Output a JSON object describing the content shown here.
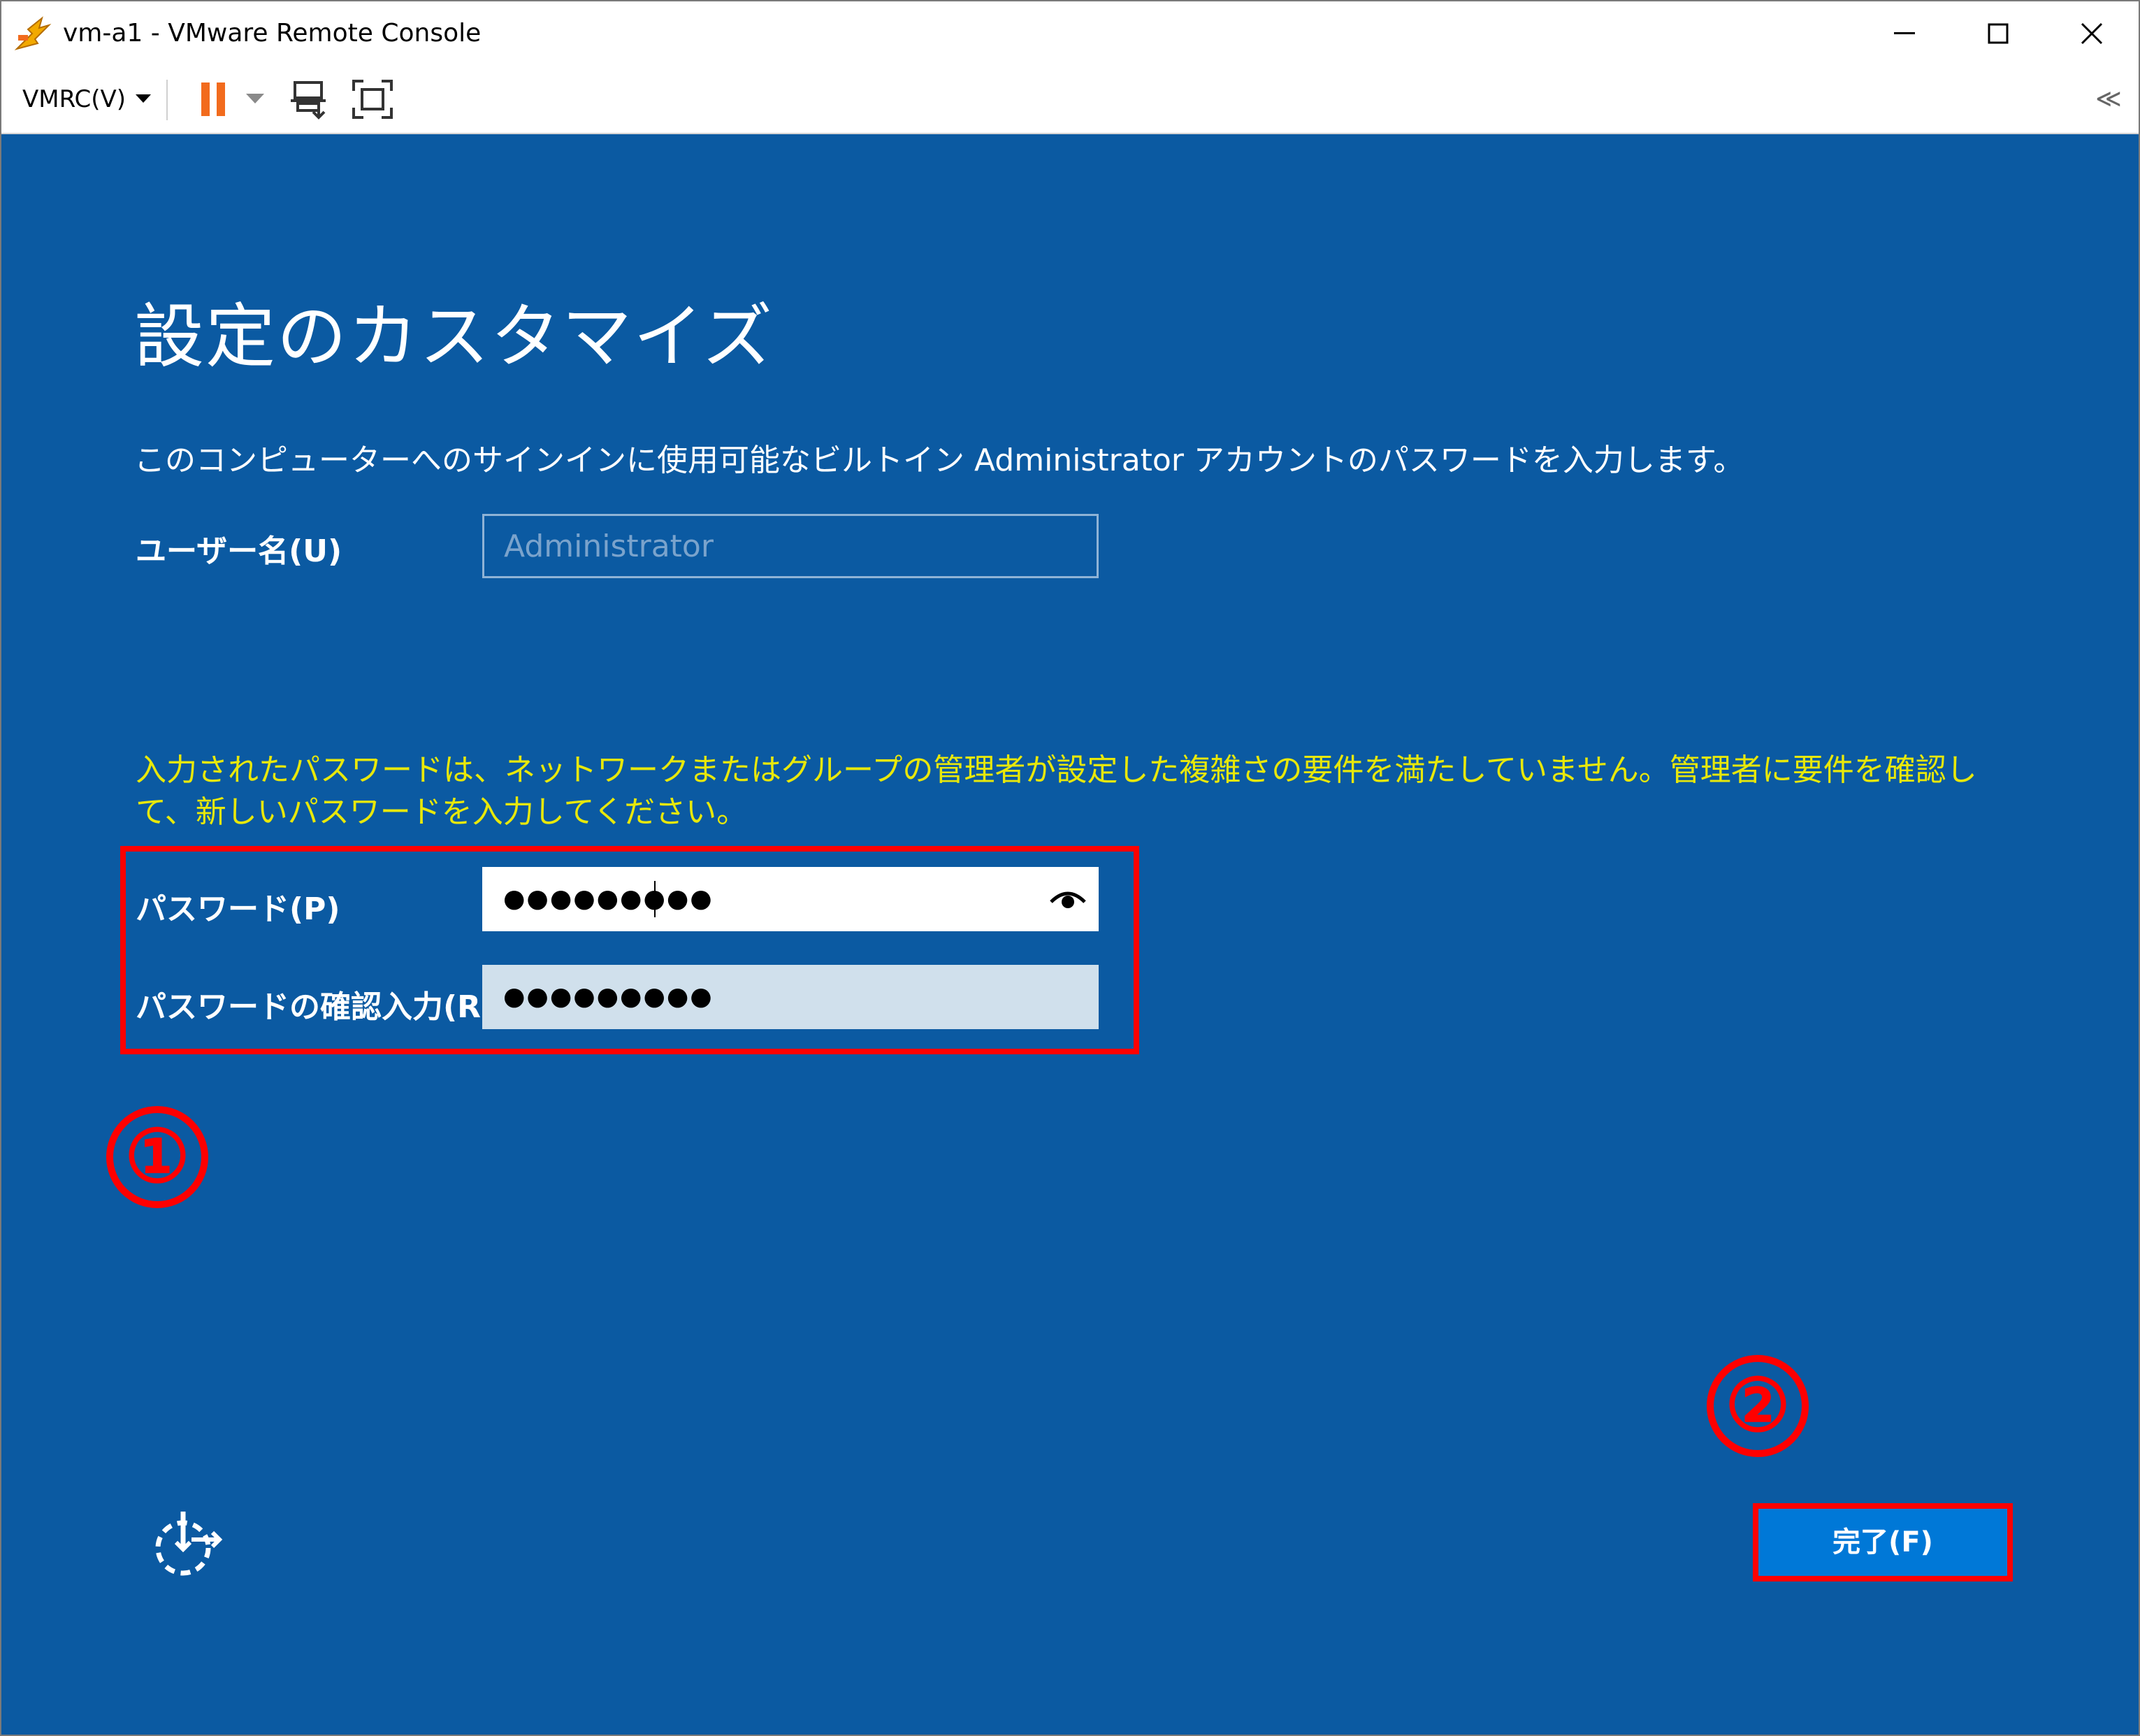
{
  "window": {
    "title": "vm-a1 - VMware Remote Console"
  },
  "toolbar": {
    "menu_label": "VMRC(V)",
    "collapse_glyph": "≪"
  },
  "oobe": {
    "heading": "設定のカスタマイズ",
    "description": "このコンピューターへのサインインに使用可能なビルトイン Administrator アカウントのパスワードを入力します。",
    "username_label": "ユーザー名(U)",
    "username_value": "Administrator",
    "warning": "入力されたパスワードは、ネットワークまたはグループの管理者が設定した複雑さの要件を満たしていません。管理者に要件を確認して、新しいパスワードを入力してください。",
    "password_label": "パスワード(P)",
    "password_masked": "●●●●●●●●●",
    "confirm_label": "パスワードの確認入力(R)",
    "confirm_masked": "●●●●●●●●●",
    "finish_button": "完了(F)"
  },
  "annotations": {
    "marker_1": "①",
    "marker_2": "②",
    "highlight_color": "#ff0000"
  },
  "colors": {
    "console_bg": "#0b5aa2",
    "warning_text": "#e8e80a",
    "button_bg": "#0078d7",
    "pause_icon": "#f26b1d"
  },
  "icons": {
    "app": "vmware-app-icon",
    "pause": "pause-icon",
    "send_keys": "send-ctrl-alt-del-icon",
    "fullscreen": "fullscreen-icon",
    "reveal_password": "eye-icon",
    "accessibility": "ease-of-access-icon"
  }
}
